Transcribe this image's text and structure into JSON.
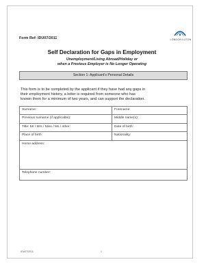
{
  "logo": {
    "text": "LONDON LUTON",
    "icon": "luton-airport-logo-mark",
    "color": "#1f5d8a"
  },
  "form_ref": "Form Ref: IDU07/2011",
  "title": "Self Declaration for Gaps in Employment",
  "subtitle_line1": "Unemployment/Living Abroad/Holiday or",
  "subtitle_line2": "when a Previous Employer is No Longer Operating",
  "section_header": "Section 1: Applicant's Personal Details",
  "intro": {
    "line1": "This form is to be completed by the applicant if they have had any gaps in",
    "line2": "their employment history, a letter is required from someone who has",
    "line3": "known them for a minimum of two years, and can support the declaration."
  },
  "fields": {
    "surname": "Surname:",
    "forename": "Forename:",
    "previous_surname": "Previous surname (if applicable):",
    "middle_names": "Middle name(s):",
    "title": "Title: Mr / Mrs / Miss / Ms / other:",
    "date_of_birth": "Date of birth:",
    "place_of_birth": "Place of birth:",
    "nationality": "Nationality:",
    "home_address": "Home address:",
    "telephone": "Telephone number:"
  },
  "footer": {
    "left": "IDU07/2011",
    "page": "1"
  },
  "colors": {
    "section_bar": "#dcdcdc",
    "border": "#777777"
  }
}
